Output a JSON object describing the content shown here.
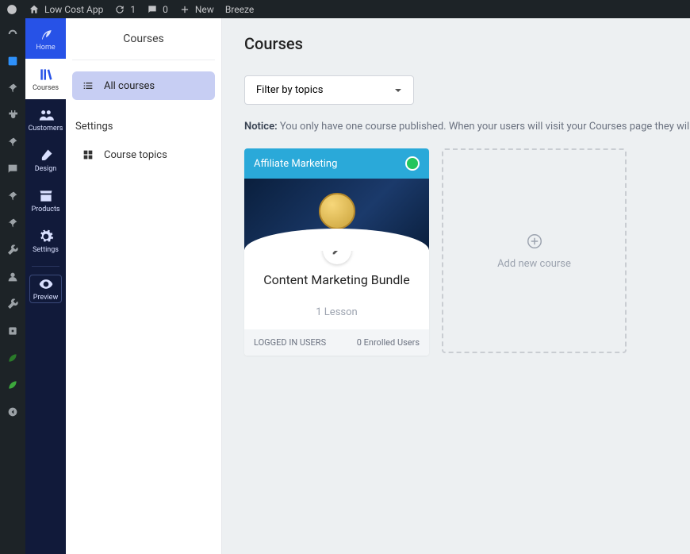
{
  "topbar": {
    "site_name": "Low Cost App",
    "updates_count": "1",
    "comments_count": "0",
    "new_label": "New",
    "breeze_label": "Breeze"
  },
  "app_rail": {
    "home": "Home",
    "courses": "Courses",
    "customers": "Customers",
    "design": "Design",
    "products": "Products",
    "settings": "Settings",
    "preview": "Preview"
  },
  "sidebar": {
    "title": "Courses",
    "all_courses": "All courses",
    "settings_section": "Settings",
    "course_topics": "Course topics"
  },
  "main": {
    "heading": "Courses",
    "filter_placeholder": "Filter by topics",
    "notice_prefix": "Notice:",
    "notice_text": " You only have one course published. When your users will visit your Courses page they will be redirect",
    "course": {
      "topic": "Affiliate Marketing",
      "title": "Content Marketing Bundle",
      "lessons": "1 Lesson",
      "logged_in": "LOGGED IN USERS",
      "enrolled": "0 Enrolled Users"
    },
    "add_course": "Add new course"
  }
}
